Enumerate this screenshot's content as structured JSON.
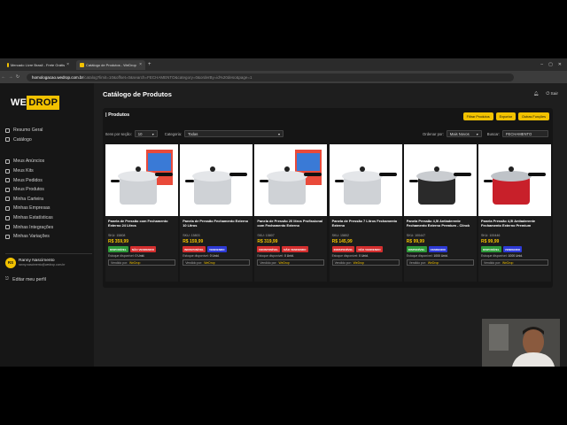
{
  "browser": {
    "tabs": [
      {
        "label": "Mercado Livre Brasil - Frete Grátis"
      },
      {
        "label": "Catálogo de Produtos - WeDrop"
      }
    ],
    "new_tab": "+",
    "url_host": "homologacao.wedrop.com.br",
    "url_rest": "/catalog?limit=10&offset=0&search=FECHAMENTO&category=0&orderBy=id%20desc&page=1"
  },
  "sidebar": {
    "logo_we": "WE",
    "logo_drop": "DROP",
    "items": [
      {
        "label": "Resumo Geral"
      },
      {
        "label": "Catálogo"
      },
      {
        "label": "Meus Anúncios"
      },
      {
        "label": "Meus Kits"
      },
      {
        "label": "Meus Pedidos"
      },
      {
        "label": "Meus Produtos"
      },
      {
        "label": "Minha Carteira"
      },
      {
        "label": "Minhas Empresas"
      },
      {
        "label": "Minhas Estatísticas"
      },
      {
        "label": "Minhas Integrações"
      },
      {
        "label": "Minhas Variações"
      }
    ],
    "user": {
      "initials": "RS",
      "name": "Ranny Nascimento",
      "email": "ranny.nascimento@wedrop.com.br"
    },
    "edit_profile": "Editar meu perfil"
  },
  "header": {
    "title": "Catálogo de Produtos",
    "logout": "Sair"
  },
  "catalog": {
    "section_title": "| Produtos",
    "buttons": {
      "filter": "Filtrar Produtos",
      "export": "Exportar",
      "help": "Outras Funções"
    },
    "filters": {
      "per_page_label": "Itens por seção:",
      "per_page_value": "10",
      "category_label": "Categoria:",
      "category_value": "Todas",
      "order_label": "Ordenar por:",
      "order_value": "Mais Novos",
      "search_label": "Buscar:",
      "search_value": "FECHAMENTO"
    },
    "stock_label": "Estoque disponível:",
    "seller_label": "Vendido por:",
    "seller_name": "WeDrop",
    "products": [
      {
        "name": "Panela de Pressão com Fechamento Externo 24 Litros",
        "sku": "SKU: 15808",
        "price": "R$ 359,99",
        "status": "DISPONÍVEL",
        "status_color": "#2e9b3a",
        "sale": "NÃO VENDENDO",
        "sale_color": "#d42e2e",
        "stock": "0 Unid."
      },
      {
        "name": "Panela de Pressão Fechamento Externo 10 Litros",
        "sku": "SKU: 15803",
        "price": "R$ 159,99",
        "status": "INDISPONÍVEL",
        "status_color": "#d42e2e",
        "sale": "VENDENDO",
        "sale_color": "#2d3ad6",
        "stock": "0 Unid."
      },
      {
        "name": "Panela de Pressão 20 litros Profissional com Fechamento Externo",
        "sku": "SKU: 15807",
        "price": "R$ 319,99",
        "status": "INDISPONÍVEL",
        "status_color": "#d42e2e",
        "sale": "NÃO VENDENDO",
        "sale_color": "#d42e2e",
        "stock": "0 Unid."
      },
      {
        "name": "Panela de Pressão 7 Litros Fechamento Externo",
        "sku": "SKU: 15802",
        "price": "R$ 145,99",
        "status": "INDISPONÍVEL",
        "status_color": "#d42e2e",
        "sale": "NÃO VENDENDO",
        "sale_color": "#d42e2e",
        "stock": "0 Unid."
      },
      {
        "name": "Panela Pressão 4,5l Antiaderente Fechamento Externo Premium - Clinck",
        "sku": "SKU: 100447",
        "price": "R$ 99,99",
        "status": "DISPONÍVEL",
        "status_color": "#2e9b3a",
        "sale": "VENDENDO",
        "sale_color": "#2d3ad6",
        "stock": "1000 Unid."
      },
      {
        "name": "Panela Pressão 4,5l Antiaderente Fechamento Externo Premium",
        "sku": "SKU: 100446",
        "price": "R$ 99,99",
        "status": "DISPONÍVEL",
        "status_color": "#2e9b3a",
        "sale": "VENDENDO",
        "sale_color": "#2d3ad6",
        "stock": "1000 Unid."
      }
    ]
  }
}
